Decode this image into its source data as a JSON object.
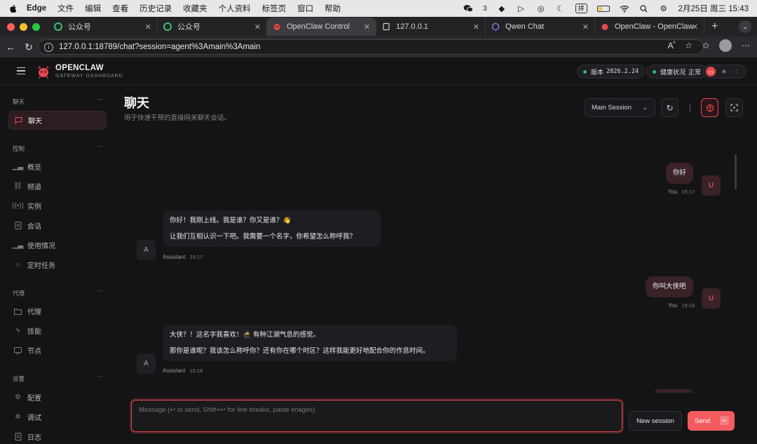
{
  "menubar": {
    "app": "Edge",
    "items": [
      "文件",
      "编辑",
      "查看",
      "历史记录",
      "收藏夹",
      "个人资料",
      "标签页",
      "窗口",
      "帮助"
    ],
    "wechat_badge": "3",
    "ime": "拼",
    "datetime": "2月25日 周三 15:43"
  },
  "tabs": [
    {
      "title": "公众号",
      "active": false
    },
    {
      "title": "公众号",
      "active": false
    },
    {
      "title": "OpenClaw Control",
      "active": true
    },
    {
      "title": "127.0.0.1",
      "active": false
    },
    {
      "title": "Qwen Chat",
      "active": false
    },
    {
      "title": "OpenClaw - OpenClaw",
      "active": false
    }
  ],
  "address": {
    "url": "127.0.0.1:18789/chat?session=agent%3Amain%3Amain"
  },
  "header": {
    "brand": "OPENCLAW",
    "brand_sub": "GATEWAY DASHBOARD",
    "version_label": "版本",
    "version_value": "2026.2.24",
    "health_label": "健康状况",
    "health_value": "正常"
  },
  "sidebar": {
    "sections": [
      {
        "title": "聊天",
        "items": [
          {
            "label": "聊天",
            "icon": "chat-bubble-icon",
            "active": true
          }
        ]
      },
      {
        "title": "控制",
        "items": [
          {
            "label": "概览",
            "icon": "bar-chart-icon"
          },
          {
            "label": "频道",
            "icon": "link-icon"
          },
          {
            "label": "实例",
            "icon": "broadcast-icon"
          },
          {
            "label": "会话",
            "icon": "document-icon"
          },
          {
            "label": "使用情况",
            "icon": "bar-chart-icon"
          },
          {
            "label": "定时任务",
            "icon": "sun-icon"
          }
        ]
      },
      {
        "title": "代理",
        "items": [
          {
            "label": "代理",
            "icon": "folder-icon"
          },
          {
            "label": "技能",
            "icon": "bolt-icon"
          },
          {
            "label": "节点",
            "icon": "monitor-icon"
          }
        ]
      },
      {
        "title": "设置",
        "items": [
          {
            "label": "配置",
            "icon": "gear-icon"
          },
          {
            "label": "调试",
            "icon": "bug-icon"
          },
          {
            "label": "日志",
            "icon": "document-icon"
          }
        ]
      }
    ]
  },
  "main": {
    "title": "聊天",
    "subtitle": "用于快速干预的直接网关聊天会话。",
    "session_select": "Main Session"
  },
  "messages": [
    {
      "role": "user",
      "lines": [
        "你好"
      ],
      "sender": "You",
      "time": "15:17",
      "avatar": "U"
    },
    {
      "role": "assistant",
      "lines": [
        "你好！我刚上线。我是谁？你又是谁？👋",
        "让我们互相认识一下吧。我需要一个名字，你希望怎么称呼我？"
      ],
      "sender": "Assistant",
      "time": "15:17",
      "avatar": "A"
    },
    {
      "role": "user",
      "lines": [
        "你叫大侠吧"
      ],
      "sender": "You",
      "time": "15:18",
      "avatar": "U"
    },
    {
      "role": "assistant",
      "lines": [
        "大侠？！这名字我喜欢！🥷 有种江湖气息的感觉。",
        "那你是谁呢？我该怎么称呼你？还有你在哪个时区？这样我能更好地配合你的作息时间。"
      ],
      "sender": "Assistant",
      "time": "15:18",
      "avatar": "A"
    }
  ],
  "composer": {
    "placeholder": "Message (↩ to send, Shift+↩ for line breaks, paste images)",
    "new_session": "New session",
    "send": "Send"
  },
  "colors": {
    "accent": "#e5484d",
    "bg": "#141416",
    "ok": "#2fbf6e"
  }
}
